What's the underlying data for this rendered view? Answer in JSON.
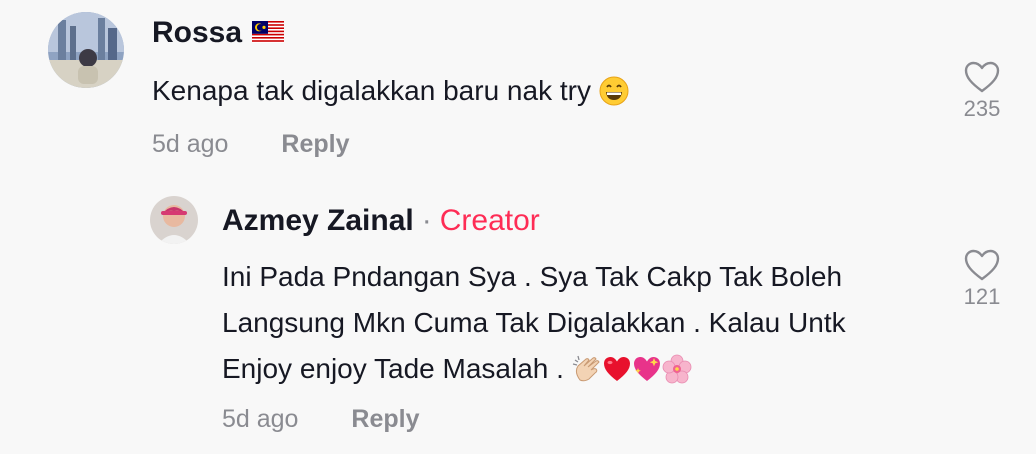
{
  "comment": {
    "author": "Rossa",
    "flag_icon": "malaysia-flag-icon",
    "text": "Kenapa tak digalakkan baru nak try",
    "emoji_icon": "grinning-face-emoji",
    "time": "5d ago",
    "reply_label": "Reply",
    "likes": "235"
  },
  "reply": {
    "author": "Azmey Zainal",
    "separator": "·",
    "badge": "Creator",
    "lines": [
      "Ini Pada Pndangan Sya . Sya Tak Cakp Tak Boleh",
      "Langsung Mkn Cuma Tak Digalakkan . Kalau Untk",
      "Enjoy enjoy Tade Masalah ."
    ],
    "emoji_icons": [
      "clapping-hands-emoji",
      "red-heart-emoji",
      "sparkling-heart-emoji",
      "cherry-blossom-emoji"
    ],
    "time": "5d ago",
    "reply_label": "Reply",
    "likes": "121"
  },
  "colors": {
    "background": "#f8f8f8",
    "text": "#161823",
    "muted": "#8a8b91",
    "creator": "#fe2c55"
  }
}
